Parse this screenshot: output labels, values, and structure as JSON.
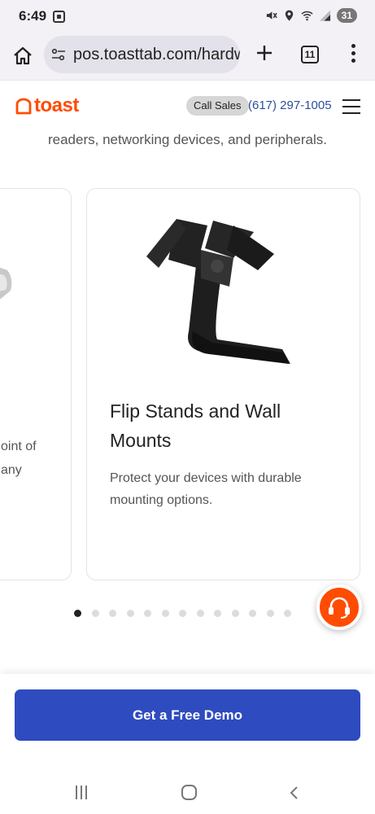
{
  "status_bar": {
    "time": "6:49",
    "battery": "31",
    "icons": [
      "screenshot-icon",
      "mute-icon",
      "location-icon",
      "wifi-icon",
      "signal-icon"
    ]
  },
  "browser": {
    "url": "pos.toasttab.com/hardware",
    "tab_count": "11",
    "icons": [
      "home-icon",
      "site-settings-icon",
      "new-tab-icon",
      "tab-switcher-icon",
      "overflow-menu-icon"
    ]
  },
  "header": {
    "logo": "toast",
    "call_sales": "Call Sales",
    "phone": "(617) 297-1005"
  },
  "intro": {
    "text": "readers, networking devices, and peripherals."
  },
  "carousel": {
    "prev_card": {
      "line1": "oint of",
      "line2": "any"
    },
    "card": {
      "title": "Flip Stands and Wall Mounts",
      "description": "Protect your devices with durable mounting options."
    },
    "active_index": 0,
    "total_dots": 13
  },
  "cta": {
    "label": "Get a Free Demo"
  },
  "colors": {
    "brand_orange": "#ff4c00",
    "cta_blue": "#2e4bbf",
    "phone_blue": "#2c4f9e"
  }
}
